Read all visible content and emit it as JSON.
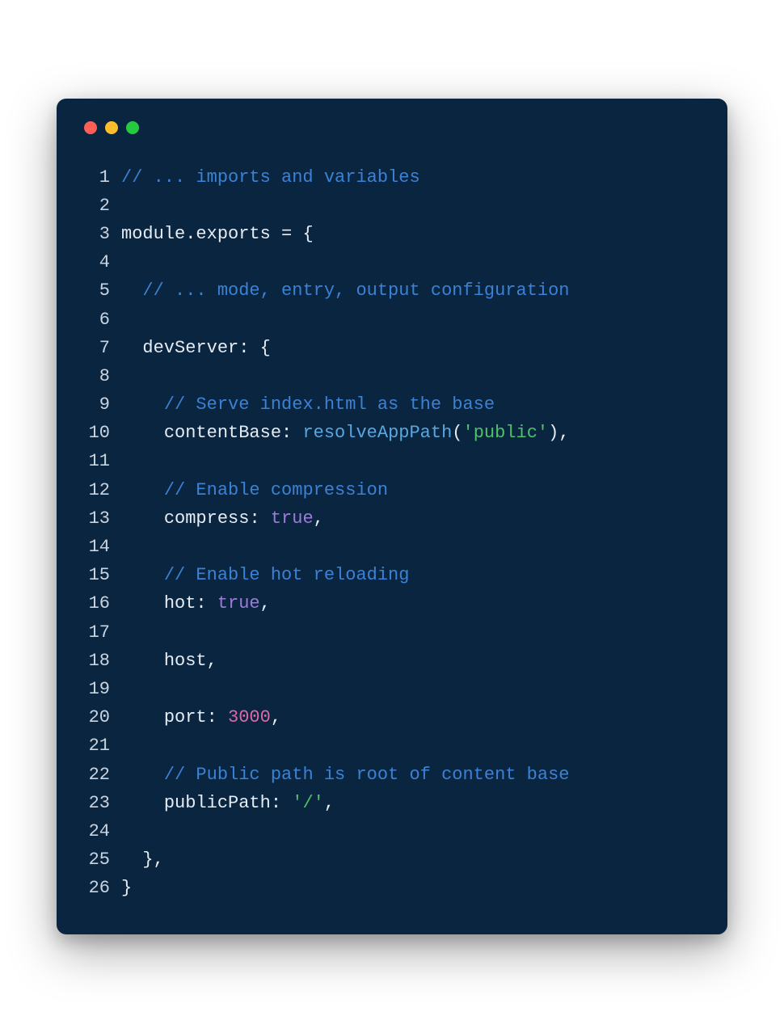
{
  "window": {
    "dots": [
      "red",
      "yellow",
      "green"
    ]
  },
  "code": {
    "lines": [
      {
        "n": "1",
        "tokens": [
          {
            "cls": "comment",
            "t": "// ... imports and variables"
          }
        ]
      },
      {
        "n": "2",
        "tokens": [
          {
            "cls": "",
            "t": ""
          }
        ]
      },
      {
        "n": "3",
        "tokens": [
          {
            "cls": "ident",
            "t": "module"
          },
          {
            "cls": "punct",
            "t": "."
          },
          {
            "cls": "ident",
            "t": "exports"
          },
          {
            "cls": "punct",
            "t": " = {"
          }
        ]
      },
      {
        "n": "4",
        "tokens": [
          {
            "cls": "",
            "t": ""
          }
        ]
      },
      {
        "n": "5",
        "tokens": [
          {
            "cls": "",
            "t": "  "
          },
          {
            "cls": "comment",
            "t": "// ... mode, entry, output configuration"
          }
        ]
      },
      {
        "n": "6",
        "tokens": [
          {
            "cls": "",
            "t": ""
          }
        ]
      },
      {
        "n": "7",
        "tokens": [
          {
            "cls": "",
            "t": "  "
          },
          {
            "cls": "ident",
            "t": "devServer"
          },
          {
            "cls": "punct",
            "t": ": {"
          }
        ]
      },
      {
        "n": "8",
        "tokens": [
          {
            "cls": "",
            "t": ""
          }
        ]
      },
      {
        "n": "9",
        "tokens": [
          {
            "cls": "",
            "t": "    "
          },
          {
            "cls": "comment",
            "t": "// Serve index.html as the base"
          }
        ]
      },
      {
        "n": "10",
        "tokens": [
          {
            "cls": "",
            "t": "    "
          },
          {
            "cls": "ident",
            "t": "contentBase"
          },
          {
            "cls": "punct",
            "t": ": "
          },
          {
            "cls": "func",
            "t": "resolveAppPath"
          },
          {
            "cls": "punct",
            "t": "("
          },
          {
            "cls": "string",
            "t": "'public'"
          },
          {
            "cls": "punct",
            "t": "),"
          }
        ]
      },
      {
        "n": "11",
        "tokens": [
          {
            "cls": "",
            "t": ""
          }
        ]
      },
      {
        "n": "12",
        "tokens": [
          {
            "cls": "",
            "t": "    "
          },
          {
            "cls": "comment",
            "t": "// Enable compression"
          }
        ]
      },
      {
        "n": "13",
        "tokens": [
          {
            "cls": "",
            "t": "    "
          },
          {
            "cls": "ident",
            "t": "compress"
          },
          {
            "cls": "punct",
            "t": ": "
          },
          {
            "cls": "keyword",
            "t": "true"
          },
          {
            "cls": "punct",
            "t": ","
          }
        ]
      },
      {
        "n": "14",
        "tokens": [
          {
            "cls": "",
            "t": ""
          }
        ]
      },
      {
        "n": "15",
        "tokens": [
          {
            "cls": "",
            "t": "    "
          },
          {
            "cls": "comment",
            "t": "// Enable hot reloading"
          }
        ]
      },
      {
        "n": "16",
        "tokens": [
          {
            "cls": "",
            "t": "    "
          },
          {
            "cls": "ident",
            "t": "hot"
          },
          {
            "cls": "punct",
            "t": ": "
          },
          {
            "cls": "keyword",
            "t": "true"
          },
          {
            "cls": "punct",
            "t": ","
          }
        ]
      },
      {
        "n": "17",
        "tokens": [
          {
            "cls": "",
            "t": ""
          }
        ]
      },
      {
        "n": "18",
        "tokens": [
          {
            "cls": "",
            "t": "    "
          },
          {
            "cls": "ident",
            "t": "host"
          },
          {
            "cls": "punct",
            "t": ","
          }
        ]
      },
      {
        "n": "19",
        "tokens": [
          {
            "cls": "",
            "t": ""
          }
        ]
      },
      {
        "n": "20",
        "tokens": [
          {
            "cls": "",
            "t": "    "
          },
          {
            "cls": "ident",
            "t": "port"
          },
          {
            "cls": "punct",
            "t": ": "
          },
          {
            "cls": "number",
            "t": "3000"
          },
          {
            "cls": "punct",
            "t": ","
          }
        ]
      },
      {
        "n": "21",
        "tokens": [
          {
            "cls": "",
            "t": ""
          }
        ]
      },
      {
        "n": "22",
        "tokens": [
          {
            "cls": "",
            "t": "    "
          },
          {
            "cls": "comment",
            "t": "// Public path is root of content base"
          }
        ]
      },
      {
        "n": "23",
        "tokens": [
          {
            "cls": "",
            "t": "    "
          },
          {
            "cls": "ident",
            "t": "publicPath"
          },
          {
            "cls": "punct",
            "t": ": "
          },
          {
            "cls": "string",
            "t": "'/'"
          },
          {
            "cls": "punct",
            "t": ","
          }
        ]
      },
      {
        "n": "24",
        "tokens": [
          {
            "cls": "",
            "t": ""
          }
        ]
      },
      {
        "n": "25",
        "tokens": [
          {
            "cls": "",
            "t": "  "
          },
          {
            "cls": "punct",
            "t": "},"
          }
        ]
      },
      {
        "n": "26",
        "tokens": [
          {
            "cls": "punct",
            "t": "}"
          }
        ]
      }
    ]
  }
}
